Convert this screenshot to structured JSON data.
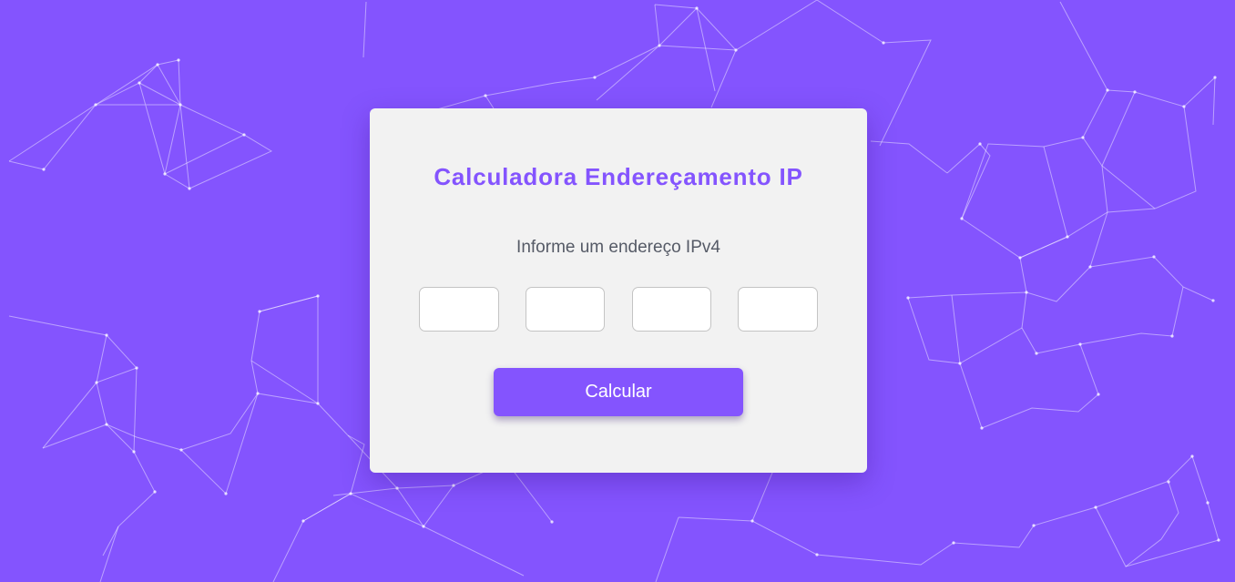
{
  "colors": {
    "background": "#8454fe",
    "accent": "#8454fe",
    "card": "#f2f2f2",
    "network_lines": "#ffffff"
  },
  "card": {
    "title": "Calculadora Endereçamento IP",
    "subtitle": "Informe um endereço IPv4"
  },
  "form": {
    "octets": [
      {
        "value": "",
        "placeholder": ""
      },
      {
        "value": "",
        "placeholder": ""
      },
      {
        "value": "",
        "placeholder": ""
      },
      {
        "value": "",
        "placeholder": ""
      }
    ],
    "submit_label": "Calcular"
  }
}
